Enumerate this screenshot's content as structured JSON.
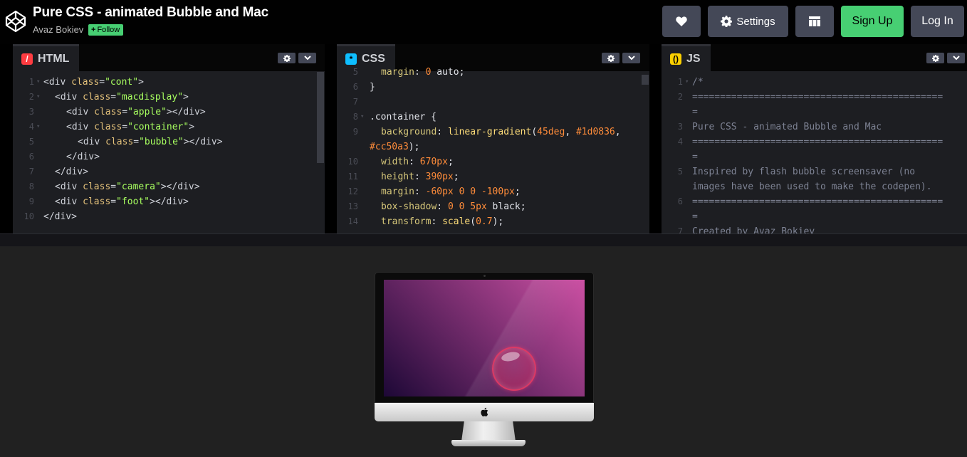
{
  "header": {
    "title": "Pure CSS - animated Bubble and Mac",
    "author": "Avaz Bokiev",
    "follow_label": "Follow",
    "settings_label": "Settings",
    "signup_label": "Sign Up",
    "login_label": "Log In"
  },
  "editors": {
    "html": {
      "label": "HTML",
      "lines": [
        {
          "n": "1",
          "fold": "▾",
          "indent": 0,
          "parts": [
            [
              "tag",
              "<div "
            ],
            [
              "attr",
              "class"
            ],
            [
              "tag",
              "="
            ],
            [
              "str",
              "\"cont\""
            ],
            [
              "tag",
              ">"
            ]
          ]
        },
        {
          "n": "2",
          "fold": "▾",
          "indent": 1,
          "parts": [
            [
              "tag",
              "<div "
            ],
            [
              "attr",
              "class"
            ],
            [
              "tag",
              "="
            ],
            [
              "str",
              "\"macdisplay\""
            ],
            [
              "tag",
              ">"
            ]
          ]
        },
        {
          "n": "3",
          "fold": "",
          "indent": 2,
          "parts": [
            [
              "tag",
              "<div "
            ],
            [
              "attr",
              "class"
            ],
            [
              "tag",
              "="
            ],
            [
              "str",
              "\"apple\""
            ],
            [
              "tag",
              "></div>"
            ]
          ]
        },
        {
          "n": "4",
          "fold": "▾",
          "indent": 2,
          "parts": [
            [
              "tag",
              "<div "
            ],
            [
              "attr",
              "class"
            ],
            [
              "tag",
              "="
            ],
            [
              "str",
              "\"container\""
            ],
            [
              "tag",
              ">"
            ]
          ]
        },
        {
          "n": "5",
          "fold": "",
          "indent": 3,
          "parts": [
            [
              "tag",
              "<div "
            ],
            [
              "attr",
              "class"
            ],
            [
              "tag",
              "="
            ],
            [
              "str",
              "\"bubble\""
            ],
            [
              "tag",
              "></div>"
            ]
          ]
        },
        {
          "n": "6",
          "fold": "",
          "indent": 2,
          "parts": [
            [
              "tag",
              "</div>"
            ]
          ]
        },
        {
          "n": "7",
          "fold": "",
          "indent": 1,
          "parts": [
            [
              "tag",
              "</div>"
            ]
          ]
        },
        {
          "n": "8",
          "fold": "",
          "indent": 1,
          "parts": [
            [
              "tag",
              "<div "
            ],
            [
              "attr",
              "class"
            ],
            [
              "tag",
              "="
            ],
            [
              "str",
              "\"camera\""
            ],
            [
              "tag",
              "></div>"
            ]
          ]
        },
        {
          "n": "9",
          "fold": "",
          "indent": 1,
          "parts": [
            [
              "tag",
              "<div "
            ],
            [
              "attr",
              "class"
            ],
            [
              "tag",
              "="
            ],
            [
              "str",
              "\"foot\""
            ],
            [
              "tag",
              "></div>"
            ]
          ]
        },
        {
          "n": "10",
          "fold": "",
          "indent": 0,
          "parts": [
            [
              "tag",
              "</div>"
            ]
          ]
        }
      ]
    },
    "css": {
      "label": "CSS",
      "lines": [
        {
          "n": "5",
          "fold": "",
          "indent": 1,
          "parts": [
            [
              "prop",
              "margin"
            ],
            [
              "sel",
              ": "
            ],
            [
              "num",
              "0"
            ],
            [
              "sel",
              " auto;"
            ]
          ]
        },
        {
          "n": "6",
          "fold": "",
          "indent": 0,
          "parts": [
            [
              "sel",
              "}"
            ]
          ]
        },
        {
          "n": "7",
          "fold": "",
          "indent": 0,
          "parts": []
        },
        {
          "n": "8",
          "fold": "▾",
          "indent": 0,
          "parts": [
            [
              "sel",
              ".container {"
            ]
          ]
        },
        {
          "n": "9",
          "fold": "",
          "indent": 1,
          "parts": [
            [
              "prop",
              "background"
            ],
            [
              "sel",
              ": "
            ],
            [
              "fn",
              "linear-gradient"
            ],
            [
              "sel",
              "("
            ],
            [
              "num",
              "45deg"
            ],
            [
              "sel",
              ", "
            ],
            [
              "num",
              "#1d0836"
            ],
            [
              "sel",
              ","
            ]
          ]
        },
        {
          "n": "",
          "fold": "",
          "indent": 0,
          "parts": [
            [
              "num",
              "#cc50a3"
            ],
            [
              "sel",
              ");"
            ]
          ]
        },
        {
          "n": "10",
          "fold": "",
          "indent": 1,
          "parts": [
            [
              "prop",
              "width"
            ],
            [
              "sel",
              ": "
            ],
            [
              "num",
              "670px"
            ],
            [
              "sel",
              ";"
            ]
          ]
        },
        {
          "n": "11",
          "fold": "",
          "indent": 1,
          "parts": [
            [
              "prop",
              "height"
            ],
            [
              "sel",
              ": "
            ],
            [
              "num",
              "390px"
            ],
            [
              "sel",
              ";"
            ]
          ]
        },
        {
          "n": "12",
          "fold": "",
          "indent": 1,
          "parts": [
            [
              "prop",
              "margin"
            ],
            [
              "sel",
              ": "
            ],
            [
              "num",
              "-60px 0 0 -100px"
            ],
            [
              "sel",
              ";"
            ]
          ]
        },
        {
          "n": "13",
          "fold": "",
          "indent": 1,
          "parts": [
            [
              "prop",
              "box-shadow"
            ],
            [
              "sel",
              ": "
            ],
            [
              "num",
              "0 0 5px"
            ],
            [
              "sel",
              " black;"
            ]
          ]
        },
        {
          "n": "14",
          "fold": "",
          "indent": 1,
          "parts": [
            [
              "prop",
              "transform"
            ],
            [
              "sel",
              ": "
            ],
            [
              "fn",
              "scale"
            ],
            [
              "sel",
              "("
            ],
            [
              "num",
              "0.7"
            ],
            [
              "sel",
              ");"
            ]
          ]
        }
      ]
    },
    "js": {
      "label": "JS",
      "lines": [
        {
          "n": "1",
          "fold": "▾",
          "indent": 0,
          "parts": [
            [
              "comment",
              "/*"
            ]
          ]
        },
        {
          "n": "2",
          "fold": "",
          "indent": 0,
          "parts": [
            [
              "comment",
              "============================================="
            ]
          ]
        },
        {
          "n": "",
          "fold": "",
          "indent": 0,
          "parts": [
            [
              "comment",
              "="
            ]
          ]
        },
        {
          "n": "3",
          "fold": "",
          "indent": 0,
          "parts": [
            [
              "comment",
              "Pure CSS - animated Bubble and Mac"
            ]
          ]
        },
        {
          "n": "4",
          "fold": "",
          "indent": 0,
          "parts": [
            [
              "comment",
              "============================================="
            ]
          ]
        },
        {
          "n": "",
          "fold": "",
          "indent": 0,
          "parts": [
            [
              "comment",
              "="
            ]
          ]
        },
        {
          "n": "5",
          "fold": "",
          "indent": 0,
          "parts": [
            [
              "comment",
              "Inspired by flash bubble screensaver (no"
            ]
          ]
        },
        {
          "n": "",
          "fold": "",
          "indent": 0,
          "parts": [
            [
              "comment",
              "images have been used to make the codepen)."
            ]
          ]
        },
        {
          "n": "6",
          "fold": "",
          "indent": 0,
          "parts": [
            [
              "comment",
              "============================================="
            ]
          ]
        },
        {
          "n": "",
          "fold": "",
          "indent": 0,
          "parts": [
            [
              "comment",
              "="
            ]
          ]
        },
        {
          "n": "7",
          "fold": "",
          "indent": 0,
          "parts": [
            [
              "comment",
              "Created by Avaz Bokiev"
            ]
          ]
        }
      ]
    }
  },
  "colors": {
    "accent_green": "#47cf73",
    "header_button": "#444857",
    "gradient_start": "#1d0836",
    "gradient_end": "#cc50a3"
  }
}
